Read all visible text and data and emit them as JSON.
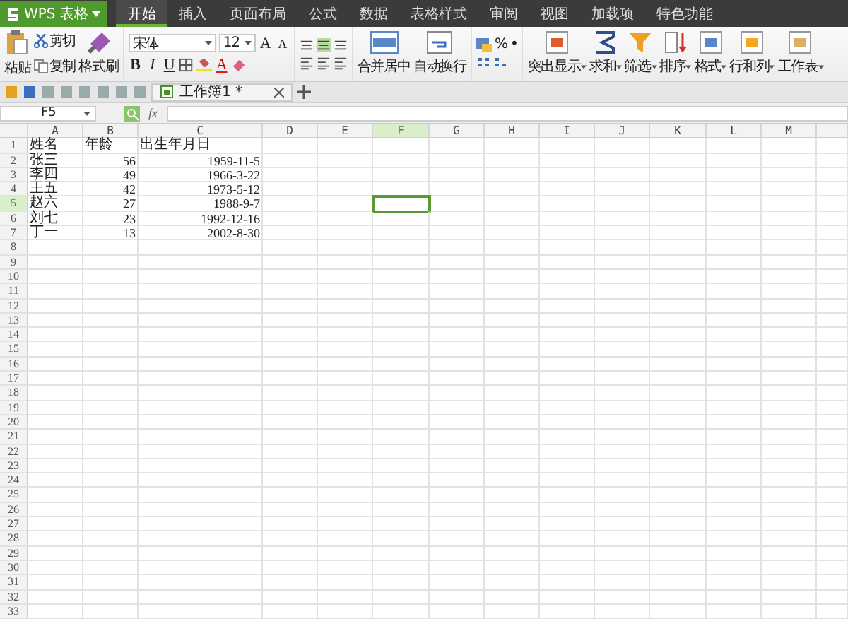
{
  "app_button": "WPS 表格",
  "menu": [
    {
      "label": "开始",
      "selected": true
    },
    {
      "label": "插入",
      "selected": false
    },
    {
      "label": "页面布局",
      "selected": false
    },
    {
      "label": "公式",
      "selected": false
    },
    {
      "label": "数据",
      "selected": false
    },
    {
      "label": "表格样式",
      "selected": false
    },
    {
      "label": "审阅",
      "selected": false
    },
    {
      "label": "视图",
      "selected": false
    },
    {
      "label": "加载项",
      "selected": false
    },
    {
      "label": "特色功能",
      "selected": false
    }
  ],
  "ribbon": {
    "paste": "粘贴",
    "cut": "剪切",
    "copy": "复制",
    "format_painter": "格式刷",
    "font_name": "宋体",
    "font_size": "12",
    "grow_font": "A",
    "shrink_font": "A",
    "bold": "B",
    "italic": "I",
    "underline": "U",
    "font_color": "A",
    "merge": "合并居中",
    "wrap": "自动换行",
    "percent": "%",
    "dot": "•",
    "tools": [
      {
        "label": "突出显示",
        "kind": "highlight"
      },
      {
        "label": "求和",
        "kind": "sum"
      },
      {
        "label": "筛选",
        "kind": "filter"
      },
      {
        "label": "排序",
        "kind": "sort"
      },
      {
        "label": "格式",
        "kind": "format"
      },
      {
        "label": "行和列",
        "kind": "rows"
      },
      {
        "label": "工作表",
        "kind": "sheet"
      }
    ]
  },
  "document_tab": {
    "title": "工作簿1 *"
  },
  "formula_bar": {
    "name_box": "F5",
    "fx": "fx"
  },
  "sheet": {
    "columns": [
      {
        "label": "A",
        "selected": false
      },
      {
        "label": "B",
        "selected": false
      },
      {
        "label": "C",
        "selected": false
      },
      {
        "label": "D",
        "selected": false
      },
      {
        "label": "E",
        "selected": false
      },
      {
        "label": "F",
        "selected": true
      },
      {
        "label": "G",
        "selected": false
      },
      {
        "label": "H",
        "selected": false
      },
      {
        "label": "I",
        "selected": false
      },
      {
        "label": "J",
        "selected": false
      },
      {
        "label": "K",
        "selected": false
      },
      {
        "label": "L",
        "selected": false
      },
      {
        "label": "M",
        "selected": false
      }
    ],
    "rows": [
      {
        "label": "1",
        "selected": false,
        "cells": [
          {
            "text": "姓名",
            "kind": "text"
          },
          {
            "text": "年龄",
            "kind": "text"
          },
          {
            "text": "出生年月日",
            "kind": "text"
          }
        ]
      },
      {
        "label": "2",
        "selected": false,
        "cells": [
          {
            "text": "张三",
            "kind": "text"
          },
          {
            "text": "56",
            "kind": "number"
          },
          {
            "text": "1959-11-5",
            "kind": "number"
          }
        ]
      },
      {
        "label": "3",
        "selected": false,
        "cells": [
          {
            "text": "李四",
            "kind": "text"
          },
          {
            "text": "49",
            "kind": "number"
          },
          {
            "text": "1966-3-22",
            "kind": "number"
          }
        ]
      },
      {
        "label": "4",
        "selected": false,
        "cells": [
          {
            "text": "王五",
            "kind": "text"
          },
          {
            "text": "42",
            "kind": "number"
          },
          {
            "text": "1973-5-12",
            "kind": "number"
          }
        ]
      },
      {
        "label": "5",
        "selected": true,
        "cells": [
          {
            "text": "赵六",
            "kind": "text"
          },
          {
            "text": "27",
            "kind": "number"
          },
          {
            "text": "1988-9-7",
            "kind": "number"
          }
        ]
      },
      {
        "label": "6",
        "selected": false,
        "cells": [
          {
            "text": "刘七",
            "kind": "text"
          },
          {
            "text": "23",
            "kind": "number"
          },
          {
            "text": "1992-12-16",
            "kind": "number"
          }
        ]
      },
      {
        "label": "7",
        "selected": false,
        "cells": [
          {
            "text": "丁一",
            "kind": "text"
          },
          {
            "text": "13",
            "kind": "number"
          },
          {
            "text": "2002-8-30",
            "kind": "number"
          }
        ]
      },
      {
        "label": "8",
        "selected": false
      },
      {
        "label": "9",
        "selected": false
      },
      {
        "label": "10",
        "selected": false
      },
      {
        "label": "11",
        "selected": false
      },
      {
        "label": "12",
        "selected": false
      },
      {
        "label": "13",
        "selected": false
      },
      {
        "label": "14",
        "selected": false
      },
      {
        "label": "15",
        "selected": false
      },
      {
        "label": "16",
        "selected": false
      },
      {
        "label": "17",
        "selected": false
      },
      {
        "label": "18",
        "selected": false
      },
      {
        "label": "19",
        "selected": false
      },
      {
        "label": "20",
        "selected": false
      },
      {
        "label": "21",
        "selected": false
      },
      {
        "label": "22",
        "selected": false
      },
      {
        "label": "23",
        "selected": false
      },
      {
        "label": "24",
        "selected": false
      },
      {
        "label": "25",
        "selected": false
      },
      {
        "label": "26",
        "selected": false
      },
      {
        "label": "27",
        "selected": false
      },
      {
        "label": "28",
        "selected": false
      },
      {
        "label": "29",
        "selected": false
      },
      {
        "label": "30",
        "selected": false
      },
      {
        "label": "31",
        "selected": false
      },
      {
        "label": "32",
        "selected": false
      },
      {
        "label": "33",
        "selected": false
      }
    ]
  }
}
